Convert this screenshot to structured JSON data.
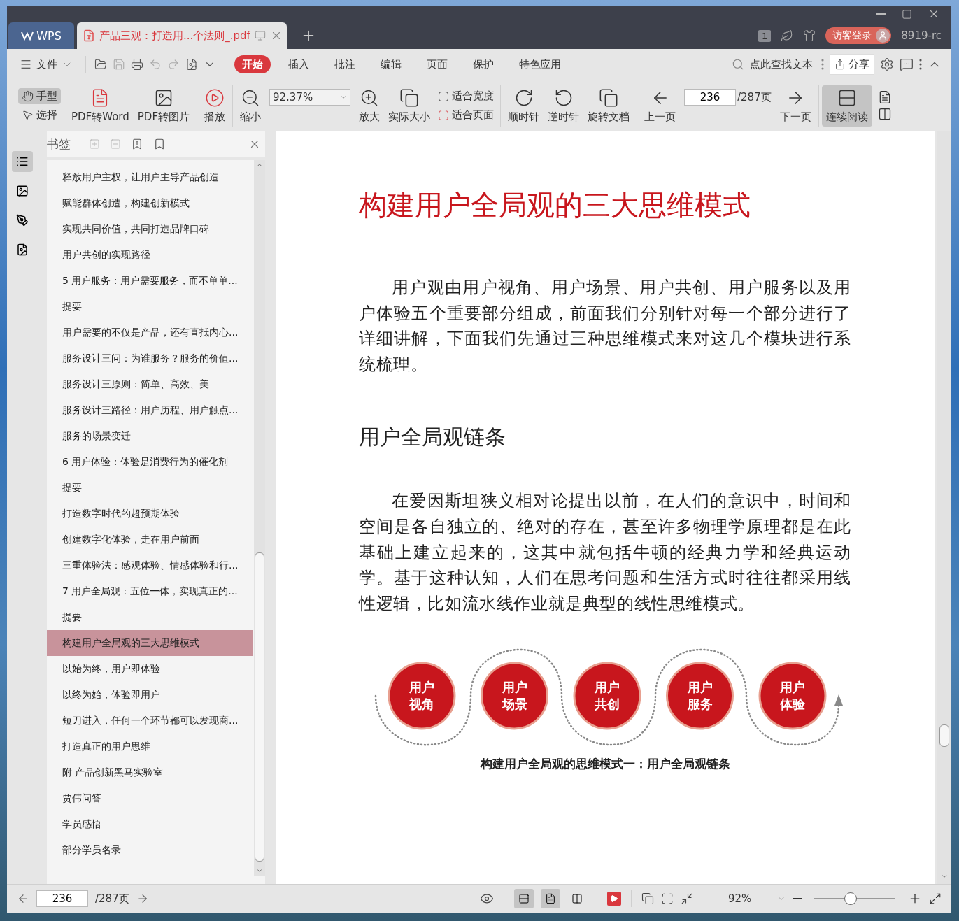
{
  "window": {
    "app_tab": "WPS",
    "doc_tab": "产品三观：打造用...个法则_.pdf",
    "doc_count": "1",
    "login": "访客登录",
    "user": "8919-rc"
  },
  "menu": {
    "file": "文件",
    "tabs": [
      {
        "label": "开始",
        "selected": true
      },
      {
        "label": "插入",
        "selected": false
      },
      {
        "label": "批注",
        "selected": false
      },
      {
        "label": "编辑",
        "selected": false
      },
      {
        "label": "页面",
        "selected": false
      },
      {
        "label": "保护",
        "selected": false
      },
      {
        "label": "特色应用",
        "selected": false
      }
    ],
    "search_placeholder": "点此查找文本",
    "share": "分享"
  },
  "toolbar": {
    "hand": {
      "label": "手型",
      "selected": true
    },
    "select": {
      "label": "选择",
      "selected": false
    },
    "pdf_to_word": "PDF转Word",
    "pdf_to_image": "PDF转图片",
    "play": "播放",
    "zoom_out": "缩小",
    "zoom_value": "92.37%",
    "zoom_in": "放大",
    "actual_size": "实际大小",
    "fit_width": "适合宽度",
    "fit_page": "适合页面",
    "clockwise": "顺时针",
    "counterclockwise": "逆时针",
    "rotate_doc": "旋转文档",
    "prev_page": "上一页",
    "page": "236",
    "page_total": "/287页",
    "next_page": "下一页",
    "continuous": {
      "label": "连续阅读",
      "selected": true
    }
  },
  "bookmarks": {
    "title": "书签",
    "items": [
      {
        "label": "释放用户主权，让用户主导产品创造",
        "selected": false
      },
      {
        "label": "赋能群体创造，构建创新模式",
        "selected": false
      },
      {
        "label": "实现共同价值，共同打造品牌口碑",
        "selected": false
      },
      {
        "label": "用户共创的实现路径",
        "selected": false
      },
      {
        "label": "5 用户服务：用户需要服务，而不单单...",
        "selected": false
      },
      {
        "label": "提要",
        "selected": false
      },
      {
        "label": "用户需要的不仅是产品，还有直抵内心...",
        "selected": false
      },
      {
        "label": "服务设计三问：为谁服务？服务的价值...",
        "selected": false
      },
      {
        "label": "服务设计三原则：简单、高效、美",
        "selected": false
      },
      {
        "label": "服务设计三路径：用户历程、用户触点...",
        "selected": false
      },
      {
        "label": "服务的场景变迁",
        "selected": false
      },
      {
        "label": "6 用户体验：体验是消费行为的催化剂",
        "selected": false
      },
      {
        "label": "提要",
        "selected": false
      },
      {
        "label": "打造数字时代的超预期体验",
        "selected": false
      },
      {
        "label": "创建数字化体验，走在用户前面",
        "selected": false
      },
      {
        "label": "三重体验法：感观体验、情感体验和行...",
        "selected": false
      },
      {
        "label": "7 用户全局观：五位一体，实现真正的...",
        "selected": false
      },
      {
        "label": "提要",
        "selected": false
      },
      {
        "label": "构建用户全局观的三大思维模式",
        "selected": true
      },
      {
        "label": "以始为终，用户即体验",
        "selected": false
      },
      {
        "label": "以终为始，体验即用户",
        "selected": false
      },
      {
        "label": "短刀进入，任何一个环节都可以发现商...",
        "selected": false
      },
      {
        "label": "打造真正的用户思维",
        "selected": false
      },
      {
        "label": "附 产品创新黑马实验室",
        "selected": false
      },
      {
        "label": "贾伟问答",
        "selected": false
      },
      {
        "label": "学员感悟",
        "selected": false
      },
      {
        "label": "部分学员名录",
        "selected": false
      }
    ]
  },
  "document": {
    "heading": "构建用户全局观的三大思维模式",
    "paragraph_1": "用户观由用户视角、用户场景、用户共创、用户服务以及用户体验五个重要部分组成，前面我们分别针对每一个部分进行了详细讲解，下面我们先通过三种思维模式来对这几个模块进行系统梳理。",
    "subheading": "用户全局观链条",
    "paragraph_2": "在爱因斯坦狭义相对论提出以前，在人们的意识中，时间和空间是各自独立的、绝对的存在，甚至许多物理学原理都是在此基础上建立起来的，这其中就包括牛顿的经典力学和经典运动学。基于这种认知，人们在思考问题和生活方式时往往都采用线性逻辑，比如流水线作业就是典型的线性思维模式。",
    "chain": [
      [
        "用户",
        "视角"
      ],
      [
        "用户",
        "场景"
      ],
      [
        "用户",
        "共创"
      ],
      [
        "用户",
        "服务"
      ],
      [
        "用户",
        "体验"
      ]
    ],
    "caption": "构建用户全局观的思维模式一：用户全局观链条"
  },
  "status_bar": {
    "page": "236",
    "page_total": "/287页",
    "view_modes": [
      {
        "selected": true
      },
      {
        "selected": true
      },
      {
        "selected": false
      }
    ],
    "zoom": "92%",
    "zoom_slider": {
      "level": 0.45
    }
  }
}
